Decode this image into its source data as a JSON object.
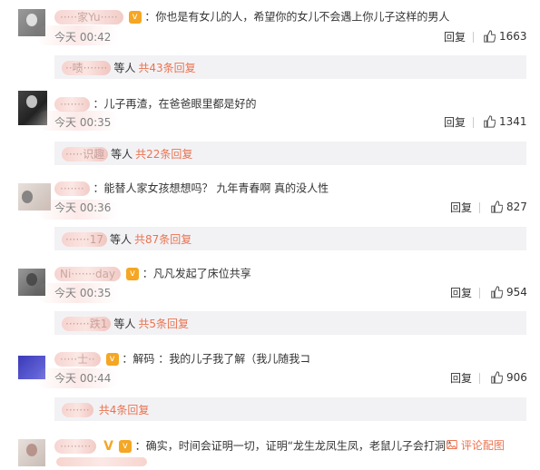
{
  "accent_color": "#eb7350",
  "reply_label": "回复",
  "comments": [
    {
      "user": "·····家Yu·····",
      "text": "你也是有女儿的人，希望你的女儿不会遇上你儿子这样的男人",
      "time": "今天 00:42",
      "likes": "1663",
      "sub_user": "··啧·······",
      "sub_who": "等人",
      "sub_more": "共43条回复"
    },
    {
      "user": "·······",
      "text": "儿子再渣，在爸爸眼里都是好的",
      "time": "今天 00:35",
      "likes": "1341",
      "sub_user": "·····识趣",
      "sub_who": "等人",
      "sub_more": "共22条回复"
    },
    {
      "user": "·······",
      "text": "能替人家女孩想想吗？ 九年青春啊 真的没人性",
      "time": "今天 00:36",
      "likes": "827",
      "sub_user": "·······17",
      "sub_who": "等人",
      "sub_more": "共87条回复"
    },
    {
      "user": "Ni·······day",
      "text": "凡凡发起了床位共享",
      "time": "今天 00:35",
      "likes": "954",
      "sub_user": "·······跌1",
      "sub_who": "等人",
      "sub_more": "共5条回复"
    },
    {
      "user": "·····士··",
      "text": "解码 ：我的儿子我了解（我儿随我コ",
      "time": "今天 00:44",
      "likes": "906",
      "sub_user": "·······",
      "sub_who": "",
      "sub_more": "共4条回复"
    },
    {
      "user": "·········",
      "text": "确实，时间会证明一切，证明“龙生龙凤生凤，老鼠儿子会打洞”",
      "link": "评论配图"
    }
  ]
}
